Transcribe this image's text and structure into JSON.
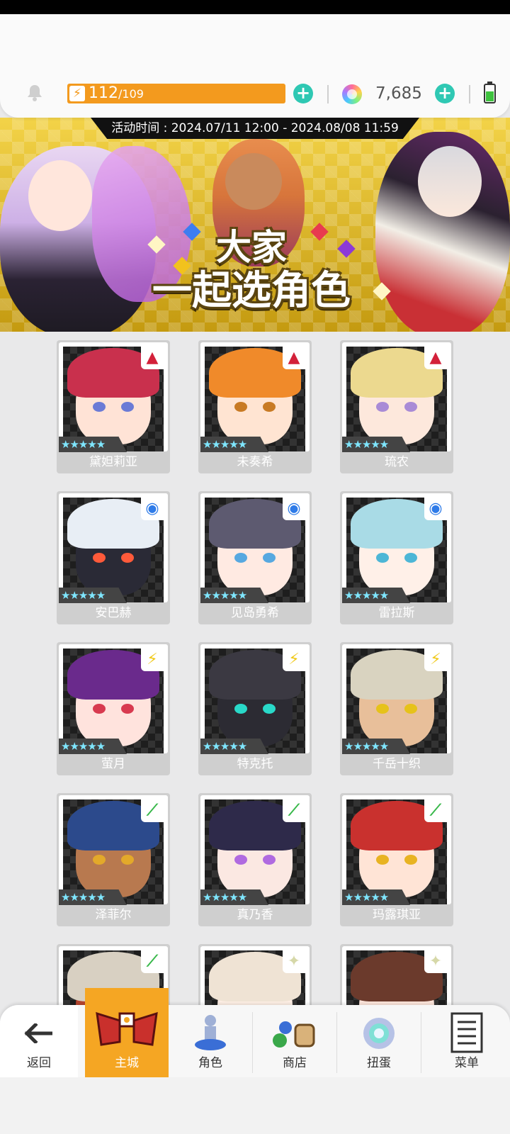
{
  "header": {
    "energy_current": "112",
    "energy_max": "/109",
    "gems": "7,685"
  },
  "event": {
    "period": "活动时间 : 2024.07/11 12:00 - 2024.08/08 11:59",
    "title_line1": "大家",
    "title_line2": "一起选角色"
  },
  "characters": [
    {
      "name": "黛妲莉亚",
      "stars": "★★★★★",
      "element": "fire-icon",
      "element_color": "#d3213a",
      "hair": "#c9304d",
      "skin": "#ffe3d6",
      "eye": "#6b7bd6"
    },
    {
      "name": "未奏希",
      "stars": "★★★★★",
      "element": "fire-icon",
      "element_color": "#d3213a",
      "hair": "#f08a2a",
      "skin": "#ffe4d2",
      "eye": "#c87a24"
    },
    {
      "name": "琉农",
      "stars": "★★★★★",
      "element": "fire-icon",
      "element_color": "#d3213a",
      "hair": "#ecd98f",
      "skin": "#fde8dc",
      "eye": "#a98bd6"
    },
    {
      "name": "安巴赫",
      "stars": "★★★★★",
      "element": "water-icon",
      "element_color": "#2e7be8",
      "hair": "#e8eef5",
      "skin": "#2a2a36",
      "eye": "#ff5a3a"
    },
    {
      "name": "见岛勇希",
      "stars": "★★★★★",
      "element": "water-icon",
      "element_color": "#2e7be8",
      "hair": "#5d5a70",
      "skin": "#ffeae2",
      "eye": "#57a8e0"
    },
    {
      "name": "雷拉斯",
      "stars": "★★★★★",
      "element": "water-icon",
      "element_color": "#2e7be8",
      "hair": "#a9dbe6",
      "skin": "#fff0e8",
      "eye": "#4db6d6"
    },
    {
      "name": "萤月",
      "stars": "★★★★★",
      "element": "thunder-icon",
      "element_color": "#f0c91a",
      "hair": "#6a2a8c",
      "skin": "#ffe3dd",
      "eye": "#d83a4f"
    },
    {
      "name": "特克托",
      "stars": "★★★★★",
      "element": "thunder-icon",
      "element_color": "#f0c91a",
      "hair": "#3b3942",
      "skin": "#2c2b33",
      "eye": "#29d9c9"
    },
    {
      "name": "千岳十织",
      "stars": "★★★★★",
      "element": "thunder-icon",
      "element_color": "#f0c91a",
      "hair": "#d9d3c0",
      "skin": "#e8bf9a",
      "eye": "#e6c21a"
    },
    {
      "name": "泽菲尔",
      "stars": "★★★★★",
      "element": "wind-icon",
      "element_color": "#38b84a",
      "hair": "#2c4a8c",
      "skin": "#b8794f",
      "eye": "#e3a92a"
    },
    {
      "name": "真乃香",
      "stars": "★★★★★",
      "element": "wind-icon",
      "element_color": "#38b84a",
      "hair": "#2e2a4a",
      "skin": "#fbe8e2",
      "eye": "#b06ae0"
    },
    {
      "name": "玛露琪亚",
      "stars": "★★★★★",
      "element": "wind-icon",
      "element_color": "#38b84a",
      "hair": "#c9312e",
      "skin": "#ffe4d6",
      "eye": "#e8b322"
    },
    {
      "name": "",
      "stars": "★★★★★",
      "element": "wind-icon",
      "element_color": "#38b84a",
      "hair": "#d8d0c2",
      "skin": "#b8462f",
      "eye": "#ffd12a"
    },
    {
      "name": "",
      "stars": "★★★★★",
      "element": "light-icon",
      "element_color": "#d6d8a8",
      "hair": "#efe3d4",
      "skin": "#fff0e6",
      "eye": "#9bb8d6"
    },
    {
      "name": "",
      "stars": "★★★★★",
      "element": "light-icon",
      "element_color": "#d6d8a8",
      "hair": "#6b3a2c",
      "skin": "#fde6dc",
      "eye": "#5a4a9c"
    }
  ],
  "nav": {
    "back": "返回",
    "home": "主城",
    "characters": "角色",
    "shop": "商店",
    "gacha": "扭蛋",
    "menu": "菜单"
  }
}
